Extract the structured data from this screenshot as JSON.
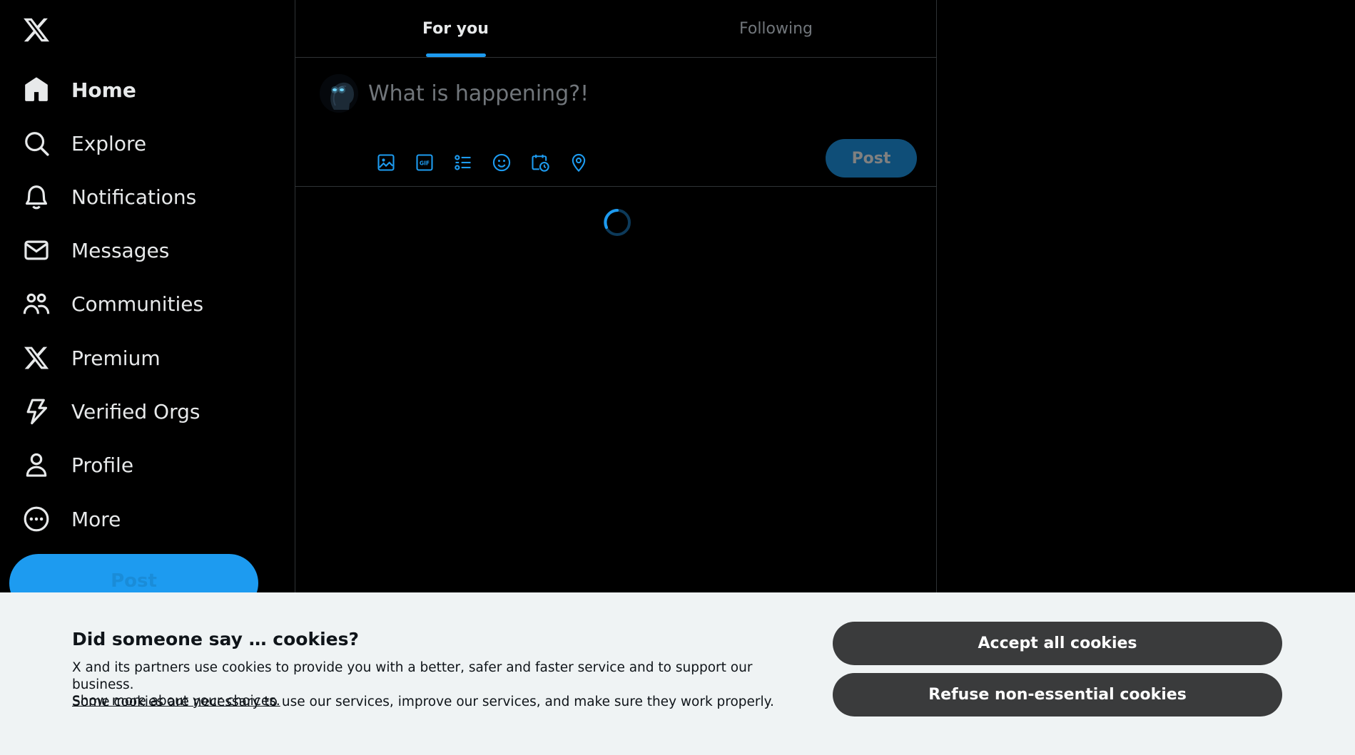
{
  "colors": {
    "background": "#000000",
    "text_primary": "#e7e9ea",
    "text_muted": "#71767b",
    "accent": "#1d9bf0",
    "divider": "#2f3336",
    "banner_bg": "#eff3f4",
    "banner_button": "#3a3b3c"
  },
  "sidebar": {
    "logo_icon": "x-logo-icon",
    "items": [
      {
        "label": "Home",
        "icon": "home-icon",
        "active": true
      },
      {
        "label": "Explore",
        "icon": "search-icon"
      },
      {
        "label": "Notifications",
        "icon": "bell-icon"
      },
      {
        "label": "Messages",
        "icon": "envelope-icon"
      },
      {
        "label": "Communities",
        "icon": "people-icon"
      },
      {
        "label": "Premium",
        "icon": "x-logo-icon"
      },
      {
        "label": "Verified Orgs",
        "icon": "lightning-icon"
      },
      {
        "label": "Profile",
        "icon": "person-icon"
      },
      {
        "label": "More",
        "icon": "more-circle-icon"
      }
    ],
    "post_button": "Post"
  },
  "main": {
    "tabs": [
      {
        "label": "For you",
        "active": true
      },
      {
        "label": "Following",
        "active": false
      }
    ],
    "composer": {
      "placeholder": "What is happening?!",
      "tools": [
        "image-icon",
        "gif-icon",
        "poll-icon",
        "emoji-icon",
        "schedule-icon",
        "location-icon"
      ],
      "post_button": "Post"
    },
    "loading": true
  },
  "cookie_banner": {
    "title": "Did someone say … cookies?",
    "text_line1": "X and its partners use cookies to provide you with a better, safer and faster service and to support our business.",
    "text_line2": "Some cookies are necessary to use our services, improve our services, and make sure they work properly.",
    "link": "Show more about your choices.",
    "accept_button": "Accept all cookies",
    "refuse_button": "Refuse non-essential cookies"
  }
}
